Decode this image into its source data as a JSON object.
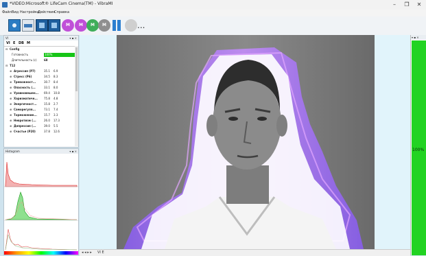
{
  "window": {
    "title": "*VIDEO:Microsoft® LifeCam Cinema(TM) - VibraMI",
    "minimize": "–",
    "maximize": "❐",
    "close": "✕"
  },
  "menu": [
    "Файл",
    "Вид",
    "Настройки",
    "Действия",
    "Справка"
  ],
  "toolbar": {
    "more": "...",
    "round_buttons": [
      {
        "label": "M",
        "color": "#c04fd8"
      },
      {
        "label": "M",
        "color": "#c04fd8"
      },
      {
        "label": "M",
        "color": "#3fae5a"
      },
      {
        "label": "M",
        "color": "#8f8f8f"
      },
      {
        "label": "",
        "color": "#cfcfcf"
      }
    ]
  },
  "left_panel": {
    "title": "VI",
    "controls": "▾ ▪ ×",
    "tabs": [
      "VI",
      "E",
      "DB",
      "M"
    ],
    "config_label": "Config",
    "fields": [
      {
        "label": "Готовность",
        "value": "100%"
      },
      {
        "label": "Длительность (с)",
        "value": "68"
      }
    ],
    "group_label": "T12",
    "rows": [
      {
        "label": "Агрессия (P7)",
        "v1": "35.1",
        "v2": "6.9"
      },
      {
        "label": "Стресс (P6)",
        "v1": "34.5",
        "v2": "8.3"
      },
      {
        "label": "Тревожност...",
        "v1": "30.7",
        "v2": "8.4"
      },
      {
        "label": "Опасность (...",
        "v1": "33.1",
        "v2": "8.0"
      },
      {
        "label": "Уравновешен...",
        "v1": "69.4",
        "v2": "10.8"
      },
      {
        "label": "Харизматичн...",
        "v1": "75.8",
        "v2": "4.8"
      },
      {
        "label": "Энергичност...",
        "v1": "15.8",
        "v2": "2.7"
      },
      {
        "label": "Саморегуля...",
        "v1": "73.1",
        "v2": "7.4"
      },
      {
        "label": "Торможение...",
        "v1": "15.7",
        "v2": "3.3"
      },
      {
        "label": "Невротизм (...",
        "v1": "26.0",
        "v2": "17.3"
      },
      {
        "label": "Депрессия (...",
        "v1": "39.0",
        "v2": "5.5"
      },
      {
        "label": "Счастье (P20)",
        "v1": "37.8",
        "v2": "12.6"
      }
    ]
  },
  "histogram_panel": {
    "title": "Histogram",
    "controls": "▾ ▪ ×"
  },
  "bottom": {
    "nav": "◂ ◂ ▸ ▸",
    "tabs": "VI  E"
  },
  "right_panel": {
    "controls": "▾ ▪ ×",
    "value": "100%",
    "color": "#22d322"
  },
  "photo_alt": "Aura visualization around face"
}
